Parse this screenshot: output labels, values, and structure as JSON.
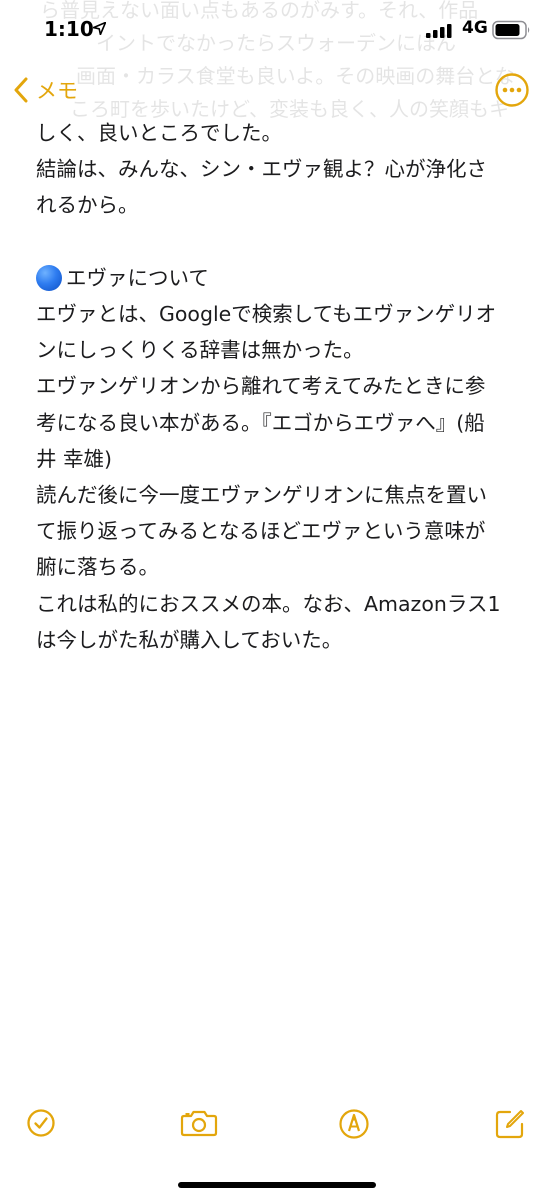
{
  "status_bar": {
    "time": "1:10",
    "network": "4G",
    "location_icon": "location-arrow-icon",
    "signal_icon": "signal-bars-icon",
    "battery_icon": "battery-icon"
  },
  "nav": {
    "back_label": "メモ",
    "back_icon": "chevron-left-icon",
    "more_icon": "ellipsis-circle-icon"
  },
  "ghost_text": [
    "ら普見えない面い点もあるのがみす。それ、作品",
    "イントでなかったらスウォーデンにほん",
    "画面・カラス食堂も良いよ。その映画の舞台とな",
    "ころ町を歩いたけど、変装も良く、人の笑顔もキ"
  ],
  "note": {
    "lines_top": [
      "しく、良いところでした。",
      "結論は、みんな、シン・エヴァ観よ？心が浄化さ",
      "れるから。"
    ],
    "heading": "エヴァについて",
    "body_lines": [
      "エヴァとは、Googleで検索してもエヴァンゲリオ",
      "ンにしっくりくる辞書は無かった。",
      "エヴァンゲリオンから離れて考えてみたときに参",
      "考になる良い本がある。『エゴからエヴァへ』(船",
      "井 幸雄)",
      "読んだ後に今一度エヴァンゲリオンに焦点を置い",
      "て振り返ってみるとなるほどエヴァという意味が",
      "腑に落ちる。",
      "これは私的におススメの本。なお、Amazonラス1",
      "は今しがた私が購入しておいた。"
    ]
  },
  "toolbar": {
    "items": [
      "checklist-icon",
      "camera-icon",
      "markup-pen-icon",
      "compose-icon"
    ]
  },
  "colors": {
    "accent": "#E3A60C",
    "text": "#1C1C1E",
    "background": "#FFFFFF"
  }
}
